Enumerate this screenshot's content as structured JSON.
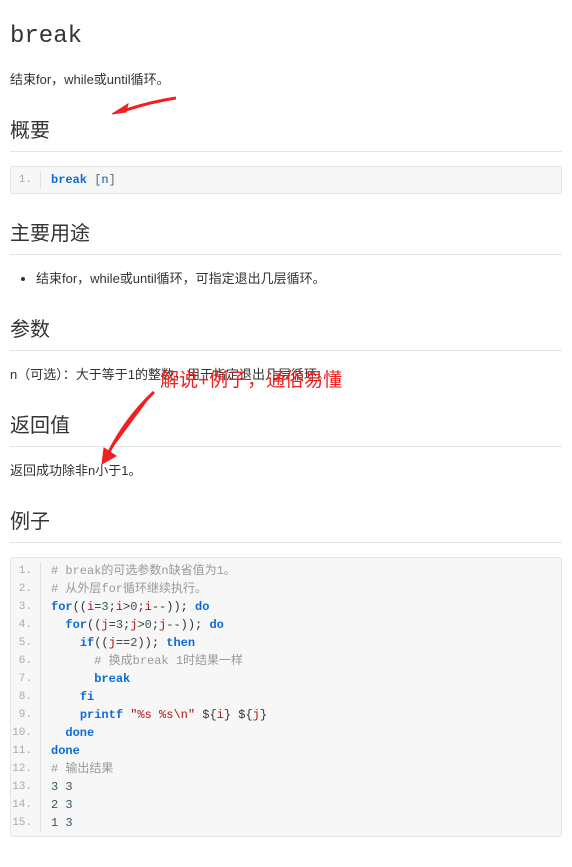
{
  "title": "break",
  "intro": "结束for，while或until循环。",
  "sections": {
    "synopsis": {
      "heading": "概要"
    },
    "usage": {
      "heading": "主要用途",
      "items": [
        "结束for，while或until循环，可指定退出几层循环。"
      ]
    },
    "params": {
      "heading": "参数",
      "text": "n（可选）：大于等于1的整数，用于指定退出几层循环。"
    },
    "return": {
      "heading": "返回值",
      "text": "返回成功除非n小于1。"
    },
    "example": {
      "heading": "例子"
    }
  },
  "codeblocks": {
    "synopsis": [
      {
        "n": "1.",
        "tokens": [
          {
            "c": "tok-kw",
            "t": "break"
          },
          {
            "c": "tok-op",
            "t": " "
          },
          {
            "c": "tok-punc",
            "t": "["
          },
          {
            "c": "tok-var",
            "t": "n"
          },
          {
            "c": "tok-punc",
            "t": "]"
          }
        ]
      }
    ],
    "example": [
      {
        "n": "1.",
        "tokens": [
          {
            "c": "tok-cmt",
            "t": "# break的可选参数n缺省值为1。"
          }
        ]
      },
      {
        "n": "2.",
        "tokens": [
          {
            "c": "tok-cmt",
            "t": "# 从外层for循环继续执行。"
          }
        ]
      },
      {
        "n": "3.",
        "tokens": [
          {
            "c": "tok-kw",
            "t": "for"
          },
          {
            "c": "tok-op",
            "t": "(("
          },
          {
            "c": "tok-str",
            "t": "i"
          },
          {
            "c": "tok-op",
            "t": "="
          },
          {
            "c": "tok-num",
            "t": "3"
          },
          {
            "c": "tok-op",
            "t": ";"
          },
          {
            "c": "tok-str",
            "t": "i"
          },
          {
            "c": "tok-op",
            "t": ">"
          },
          {
            "c": "tok-num",
            "t": "0"
          },
          {
            "c": "tok-op",
            "t": ";"
          },
          {
            "c": "tok-str",
            "t": "i"
          },
          {
            "c": "tok-op",
            "t": "--"
          },
          {
            "c": "tok-op",
            "t": "));"
          },
          {
            "c": "tok-kw",
            "t": " do"
          }
        ]
      },
      {
        "n": "4.",
        "tokens": [
          {
            "c": "tok-op",
            "t": "  "
          },
          {
            "c": "tok-kw",
            "t": "for"
          },
          {
            "c": "tok-op",
            "t": "(("
          },
          {
            "c": "tok-str",
            "t": "j"
          },
          {
            "c": "tok-op",
            "t": "="
          },
          {
            "c": "tok-num",
            "t": "3"
          },
          {
            "c": "tok-op",
            "t": ";"
          },
          {
            "c": "tok-str",
            "t": "j"
          },
          {
            "c": "tok-op",
            "t": ">"
          },
          {
            "c": "tok-num",
            "t": "0"
          },
          {
            "c": "tok-op",
            "t": ";"
          },
          {
            "c": "tok-str",
            "t": "j"
          },
          {
            "c": "tok-op",
            "t": "--"
          },
          {
            "c": "tok-op",
            "t": "));"
          },
          {
            "c": "tok-kw",
            "t": " do"
          }
        ]
      },
      {
        "n": "5.",
        "tokens": [
          {
            "c": "tok-op",
            "t": "    "
          },
          {
            "c": "tok-kw",
            "t": "if"
          },
          {
            "c": "tok-op",
            "t": "(("
          },
          {
            "c": "tok-str",
            "t": "j"
          },
          {
            "c": "tok-op",
            "t": "=="
          },
          {
            "c": "tok-num",
            "t": "2"
          },
          {
            "c": "tok-op",
            "t": "));"
          },
          {
            "c": "tok-kw",
            "t": " then"
          }
        ]
      },
      {
        "n": "6.",
        "tokens": [
          {
            "c": "tok-op",
            "t": "      "
          },
          {
            "c": "tok-cmt",
            "t": "# 换成break 1时结果一样"
          }
        ]
      },
      {
        "n": "7.",
        "tokens": [
          {
            "c": "tok-op",
            "t": "      "
          },
          {
            "c": "tok-kw",
            "t": "break"
          }
        ]
      },
      {
        "n": "8.",
        "tokens": [
          {
            "c": "tok-op",
            "t": "    "
          },
          {
            "c": "tok-kw",
            "t": "fi"
          }
        ]
      },
      {
        "n": "9.",
        "tokens": [
          {
            "c": "tok-op",
            "t": "    "
          },
          {
            "c": "tok-kw",
            "t": "printf"
          },
          {
            "c": "tok-op",
            "t": " "
          },
          {
            "c": "tok-str",
            "t": "\"%s %s\\n\""
          },
          {
            "c": "tok-op",
            "t": " ${"
          },
          {
            "c": "tok-str",
            "t": "i"
          },
          {
            "c": "tok-op",
            "t": "} ${"
          },
          {
            "c": "tok-str",
            "t": "j"
          },
          {
            "c": "tok-op",
            "t": "}"
          }
        ]
      },
      {
        "n": "10.",
        "tokens": [
          {
            "c": "tok-op",
            "t": "  "
          },
          {
            "c": "tok-kw",
            "t": "done"
          }
        ]
      },
      {
        "n": "11.",
        "tokens": [
          {
            "c": "tok-kw",
            "t": "done"
          }
        ]
      },
      {
        "n": "12.",
        "tokens": [
          {
            "c": "tok-cmt",
            "t": "# 输出结果"
          }
        ]
      },
      {
        "n": "13.",
        "tokens": [
          {
            "c": "tok-num",
            "t": "3 3"
          }
        ]
      },
      {
        "n": "14.",
        "tokens": [
          {
            "c": "tok-num",
            "t": "2 3"
          }
        ]
      },
      {
        "n": "15.",
        "tokens": [
          {
            "c": "tok-num",
            "t": "1 3"
          }
        ]
      }
    ]
  },
  "annotations": {
    "callout_text": "解说+例子，通俗易懂"
  }
}
